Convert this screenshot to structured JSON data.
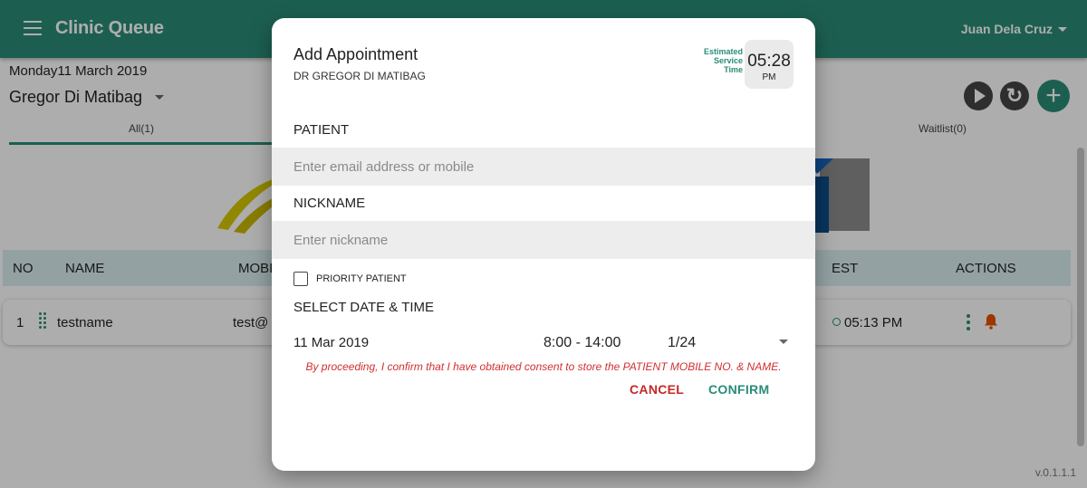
{
  "app": {
    "title": "Clinic Queue",
    "user_name": "Juan Dela Cruz",
    "version": "v.0.1.1.1"
  },
  "header": {
    "date": "Monday11 March 2019",
    "doctor": "Gregor Di Matibag"
  },
  "tabs": [
    {
      "label": "All(1)"
    },
    {
      "label": "Waitlist(0)"
    }
  ],
  "table": {
    "columns": [
      "NO",
      "NAME",
      "MOBI",
      "EST",
      "ACTIONS"
    ],
    "rows": [
      {
        "no": "1",
        "name": "testname",
        "mobile": "test@",
        "est": "05:13 PM"
      }
    ]
  },
  "dialog": {
    "title": "Add Appointment",
    "subtitle": "DR GREGOR DI MATIBAG",
    "est_label": "Estimated Service Time",
    "est_time": "05:28",
    "est_ampm": "PM",
    "patient_label": "PATIENT",
    "patient_placeholder": "Enter email address or mobile",
    "nickname_label": "NICKNAME",
    "nickname_placeholder": "Enter nickname",
    "priority_label": "PRIORITY PATIENT",
    "priority_checked": false,
    "datetime_label": "SELECT DATE & TIME",
    "date": "11 Mar 2019",
    "time_range": "8:00 - 14:00",
    "slot": "1/24",
    "consent": "By proceeding, I confirm that I have obtained consent to store the PATIENT MOBILE NO. & NAME.",
    "cancel_label": "CANCEL",
    "confirm_label": "CONFIRM"
  },
  "colors": {
    "primary": "#2a8c78",
    "danger": "#d32f2f",
    "header_row": "#d9eef0",
    "bell": "#e65100"
  },
  "icons": [
    "menu-icon",
    "chevron-down-icon",
    "play-icon",
    "refresh-icon",
    "add-icon",
    "drag-handle-icon",
    "clock-icon",
    "more-vert-icon",
    "bell-icon",
    "checkbox-icon"
  ]
}
